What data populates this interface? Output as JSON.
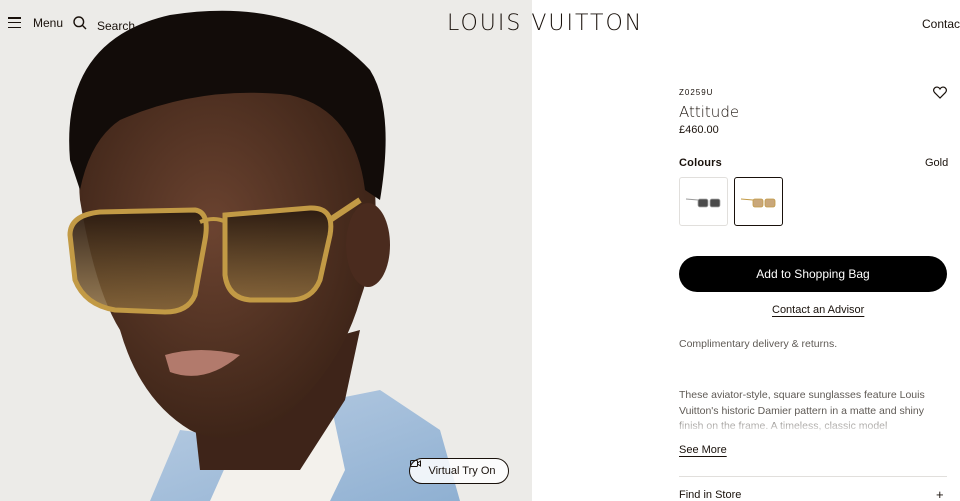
{
  "header": {
    "menu_label": "Menu",
    "search_label": "Search",
    "logo": "LOUIS VUITTON",
    "contact_label": "Contact u"
  },
  "hero": {
    "virtual_try_on_label": "Virtual Try On"
  },
  "product": {
    "sku": "Z0259U",
    "name": "Attitude",
    "price": "£460.00",
    "colours_label": "Colours",
    "selected_colour": "Gold",
    "add_to_bag_label": "Add to Shopping Bag",
    "contact_advisor_label": "Contact an Advisor",
    "delivery_text": "Complimentary delivery & returns.",
    "description": "These aviator-style, square sunglasses feature Louis Vuitton's historic Damier pattern in a matte and shiny finish on the frame. A timeless, classic model",
    "see_more_label": "See More",
    "find_in_store_label": "Find in Store",
    "expand_symbol": "+"
  },
  "icons": {
    "menu": "hamburger-icon",
    "search": "magnifier-icon",
    "wishlist": "heart-icon",
    "camera": "video-camera-icon"
  }
}
